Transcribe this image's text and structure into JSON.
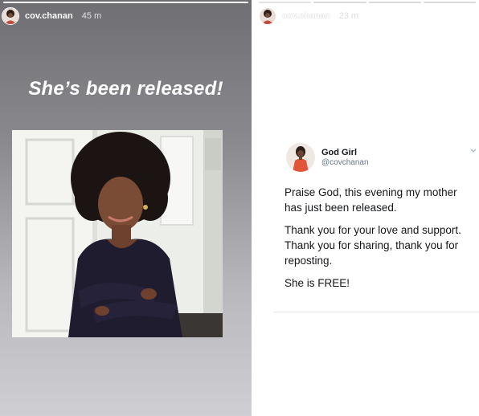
{
  "left_story": {
    "username": "cov.chanan",
    "timestamp": "45 m",
    "headline": "She’s been released!",
    "progress_segments": 1,
    "progress_done": 1
  },
  "right_story": {
    "username": "cov.chanan",
    "timestamp": "23 m",
    "progress_segments": 4,
    "progress_done": 1,
    "tweet": {
      "display_name": "God Girl",
      "handle": "@covchanan",
      "paragraphs": [
        "Praise God, this evening my mother has just been released.",
        "Thank you for your love and support. Thank you for sharing, thank you for reposting.",
        "She is FREE!"
      ]
    }
  },
  "colors": {
    "story_gradient_top": "#6e6e73",
    "story_gradient_bottom": "#cfcfd3",
    "tweet_text": "#14171a",
    "tweet_handle": "#657786"
  }
}
